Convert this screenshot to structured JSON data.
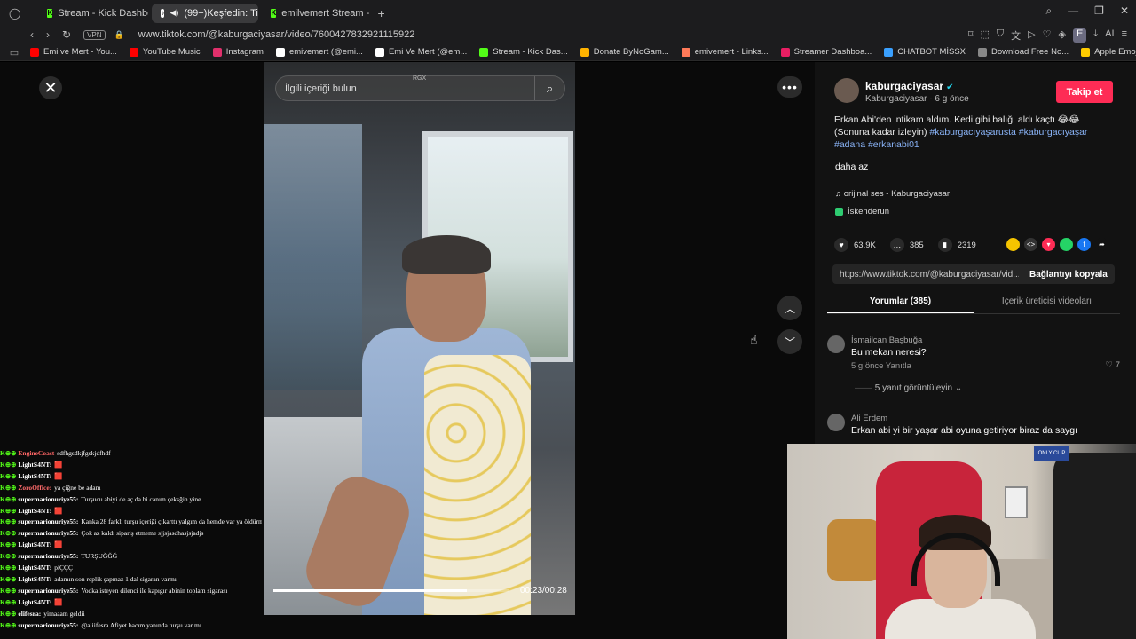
{
  "browser": {
    "tabs": [
      {
        "label": "Stream - Kick Dashboard",
        "active": false
      },
      {
        "label": "(99+)Keşfedin: TikTo",
        "active": true
      },
      {
        "label": "emilvemert Stream - Kick",
        "active": false
      }
    ],
    "url": "www.tiktok.com/@kaburgaciyasar/video/7600427832921115922",
    "vpn_label": "VPN",
    "ext_badge": "E",
    "ai_label": "AI",
    "bookmarks": [
      {
        "label": "Emi ve Mert - You...",
        "color": "#ff0000"
      },
      {
        "label": "YouTube Music",
        "color": "#ff0000"
      },
      {
        "label": "Instagram",
        "color": "#e1306c"
      },
      {
        "label": "emivemert (@emi...",
        "color": "#ffffff"
      },
      {
        "label": "Emi Ve Mert (@em...",
        "color": "#ffffff"
      },
      {
        "label": "Stream - Kick Das...",
        "color": "#53fc18"
      },
      {
        "label": "Donate ByNoGam...",
        "color": "#ffb300"
      },
      {
        "label": "emivemert - Links...",
        "color": "#ff7a59"
      },
      {
        "label": "Streamer Dashboa...",
        "color": "#e91e63"
      },
      {
        "label": "CHATBOT MİSSX",
        "color": "#3aa0ff"
      },
      {
        "label": "Download Free No...",
        "color": "#888888"
      },
      {
        "label": "Apple Emoji listesi...",
        "color": "#ffcc00"
      }
    ]
  },
  "viewer": {
    "search_placeholder": "İlgili içeriği bulun",
    "search_tag": "RGX",
    "time": "00:23/00:28",
    "progress": 0.82
  },
  "post": {
    "author": "kaburgaciyasar",
    "author_sub": "Kaburgaciyasar · 6 g önce",
    "follow_label": "Takip et",
    "desc_text": "Erkan Abi'den intikam aldım. Kedi gibi balığı aldı kaçtı 😂😂 (Sonuna kadar izleyin) ",
    "desc_tags": "#kaburgacıyaşarusta #kaburgacıyaşar #adana #erkanabi01",
    "daha_az": "daha az",
    "sound": "♫  orijinal ses - Kaburgaciyasar",
    "location": "İskenderun",
    "likes": "63.9K",
    "comments": "385",
    "saves": "2319",
    "link": "https://www.tiktok.com/@kaburgaciyasar/vid...",
    "copy_label": "Bağlantıyı kopyala",
    "tab_comments": "Yorumlar (385)",
    "tab_creator": "İçerik üreticisi videoları"
  },
  "comments": [
    {
      "user": "İsmailcan Başbuğa",
      "text": "Bu mekan neresi?",
      "meta": "5 g önce    Yanıtla",
      "likes": "♡ 7"
    },
    {
      "user": "Ali Erdem",
      "text": "Erkan abi yi bir yaşar abi oyuna getiriyor biraz da saygı",
      "meta": "",
      "likes": ""
    }
  ],
  "replies_label": "5 yanıt görüntüleyin ⌄",
  "chat": [
    {
      "user": "EngineCoast",
      "color": "#ff6666",
      "msg": "sdfhgsdkjfgskjdfhdf"
    },
    {
      "user": "LightS4NT:",
      "color": "#ffffff",
      "msg": "🟥"
    },
    {
      "user": "LightS4NT:",
      "color": "#ffffff",
      "msg": "🟥"
    },
    {
      "user": "ZoroOffice:",
      "color": "#ff6b6b",
      "msg": "ya çiğne be adam"
    },
    {
      "user": "supermarionuriye55:",
      "color": "#ffffff",
      "msg": "Turşucu abiyi de aç da bi canım çeksğin yine"
    },
    {
      "user": "LightS4NT:",
      "color": "#ffffff",
      "msg": "🟥"
    },
    {
      "user": "supermarionuriye55:",
      "color": "#ffffff",
      "msg": "Kanka 28 farklı turşu içeriği çıkarttı yalgım da hemde var ya öldürm ya arada izleyip ediyorum kendine"
    },
    {
      "user": "supermarionuriye55:",
      "color": "#ffffff",
      "msg": "Çok az kaldı sipariş etmeme sjjsjasdhasjsjadjs"
    },
    {
      "user": "LightS4NT:",
      "color": "#ffffff",
      "msg": "🟥"
    },
    {
      "user": "supermarionuriye55:",
      "color": "#ffffff",
      "msg": "TURŞUĞĞĞ"
    },
    {
      "user": "LightS4NT:",
      "color": "#ffffff",
      "msg": "piÇÇÇ"
    },
    {
      "user": "LightS4NT:",
      "color": "#ffffff",
      "msg": "adamın son replik şapmaz 1 dal sigaran varmı"
    },
    {
      "user": "supermarionuriye55:",
      "color": "#ffffff",
      "msg": "Vodka isteyen dilenci ile kapıgır abinin toplam sigarası"
    },
    {
      "user": "LightS4NT:",
      "color": "#ffffff",
      "msg": "🟥"
    },
    {
      "user": "elifesra:",
      "color": "#ffffff",
      "msg": "yimaaam geldii"
    },
    {
      "user": "supermarionuriye55:",
      "color": "#ffffff",
      "msg": "@aliifesra Afiyet bacım yanında turşu var mı"
    }
  ],
  "webcam": {
    "logo_text": "ONLY CLIP"
  }
}
